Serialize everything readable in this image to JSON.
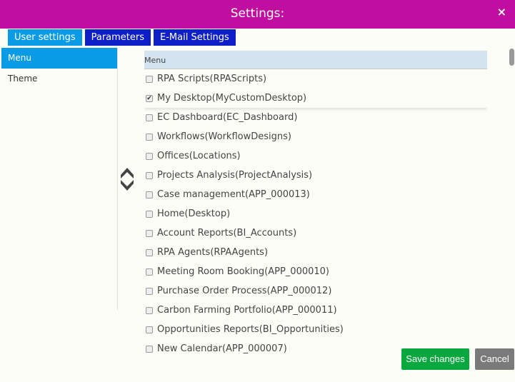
{
  "title": "Settings:",
  "close_icon": "×",
  "tabs": [
    {
      "label": "User settings",
      "active": true
    },
    {
      "label": "Parameters"
    },
    {
      "label": "E-Mail Settings"
    }
  ],
  "left_menu": [
    {
      "label": "Menu",
      "active": true
    },
    {
      "label": "Theme"
    }
  ],
  "list": {
    "header": "Menu",
    "items": [
      {
        "label": "RPA Scripts(RPAScripts)",
        "checked": false
      },
      {
        "label": "My Desktop(MyCustomDesktop)",
        "checked": true
      },
      {
        "label": "EC Dashboard(EC_Dashboard)",
        "checked": false
      },
      {
        "label": "Workflows(WorkflowDesigns)",
        "checked": false
      },
      {
        "label": "Offices(Locations)",
        "checked": false
      },
      {
        "label": "Projects Analysis(ProjectAnalysis)",
        "checked": false
      },
      {
        "label": "Case management(APP_000013)",
        "checked": false
      },
      {
        "label": "Home(Desktop)",
        "checked": false
      },
      {
        "label": "Account Reports(BI_Accounts)",
        "checked": false
      },
      {
        "label": "RPA Agents(RPAAgents)",
        "checked": false
      },
      {
        "label": "Meeting Room Booking(APP_000010)",
        "checked": false
      },
      {
        "label": "Purchase Order Process(APP_000012)",
        "checked": false
      },
      {
        "label": "Carbon Farming Portfolio(APP_000011)",
        "checked": false
      },
      {
        "label": "Opportunities Reports(BI_Opportunities)",
        "checked": false
      },
      {
        "label": "New Calendar(APP_000007)",
        "checked": false
      }
    ]
  },
  "buttons": {
    "save": "Save changes",
    "cancel": "Cancel"
  },
  "colors": {
    "titlebar": "#c00ea0",
    "tab_active": "#0a9be6",
    "tab": "#0f1fc8",
    "save": "#08a83e",
    "cancel": "#7a7a7a"
  }
}
